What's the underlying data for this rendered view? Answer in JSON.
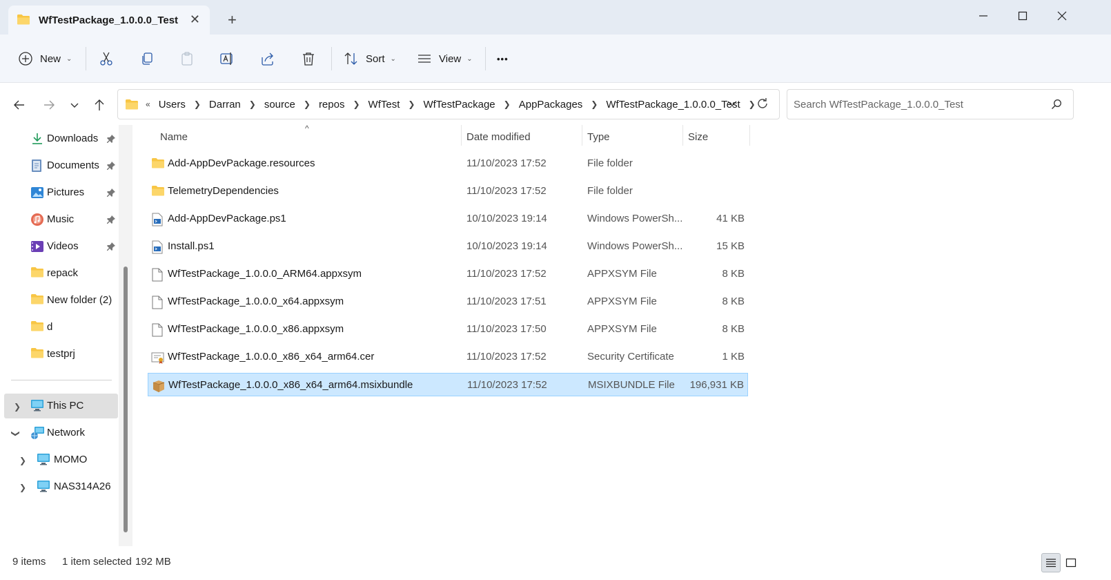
{
  "window": {
    "tab_title": "WfTestPackage_1.0.0.0_Test",
    "new_tab_symbol": "+",
    "close_tab_symbol": "✕"
  },
  "toolbar": {
    "new_label": "New",
    "sort_label": "Sort",
    "view_label": "View",
    "more_symbol": "•••"
  },
  "address": {
    "overflow_symbol": "«",
    "breadcrumbs": [
      "Users",
      "Darran",
      "source",
      "repos",
      "WfTest",
      "WfTestPackage",
      "AppPackages",
      "WfTestPackage_1.0.0.0_Test"
    ]
  },
  "search": {
    "placeholder": "Search WfTestPackage_1.0.0.0_Test"
  },
  "sidebar": {
    "quick_access": [
      {
        "label": "Downloads",
        "icon": "download-icon",
        "pinned": true
      },
      {
        "label": "Documents",
        "icon": "documents-icon",
        "pinned": true
      },
      {
        "label": "Pictures",
        "icon": "pictures-icon",
        "pinned": true
      },
      {
        "label": "Music",
        "icon": "music-icon",
        "pinned": true
      },
      {
        "label": "Videos",
        "icon": "videos-icon",
        "pinned": true
      },
      {
        "label": "repack",
        "icon": "folder-icon",
        "pinned": false
      },
      {
        "label": "New folder (2)",
        "icon": "folder-icon",
        "pinned": false
      },
      {
        "label": "d",
        "icon": "folder-icon",
        "pinned": false
      },
      {
        "label": "testprj",
        "icon": "folder-icon",
        "pinned": false
      }
    ],
    "this_pc": "This PC",
    "network": "Network",
    "network_children": [
      "MOMO",
      "NAS314A26"
    ]
  },
  "columns": {
    "name": "Name",
    "date": "Date modified",
    "type": "Type",
    "size": "Size"
  },
  "files": [
    {
      "name": "Add-AppDevPackage.resources",
      "date": "11/10/2023 17:52",
      "type": "File folder",
      "size": "",
      "icon": "folder-icon"
    },
    {
      "name": "TelemetryDependencies",
      "date": "11/10/2023 17:52",
      "type": "File folder",
      "size": "",
      "icon": "folder-icon"
    },
    {
      "name": "Add-AppDevPackage.ps1",
      "date": "10/10/2023 19:14",
      "type": "Windows PowerSh...",
      "size": "41 KB",
      "icon": "powershell-script-icon"
    },
    {
      "name": "Install.ps1",
      "date": "10/10/2023 19:14",
      "type": "Windows PowerSh...",
      "size": "15 KB",
      "icon": "powershell-script-icon"
    },
    {
      "name": "WfTestPackage_1.0.0.0_ARM64.appxsym",
      "date": "11/10/2023 17:52",
      "type": "APPXSYM File",
      "size": "8 KB",
      "icon": "generic-file-icon"
    },
    {
      "name": "WfTestPackage_1.0.0.0_x64.appxsym",
      "date": "11/10/2023 17:51",
      "type": "APPXSYM File",
      "size": "8 KB",
      "icon": "generic-file-icon"
    },
    {
      "name": "WfTestPackage_1.0.0.0_x86.appxsym",
      "date": "11/10/2023 17:50",
      "type": "APPXSYM File",
      "size": "8 KB",
      "icon": "generic-file-icon"
    },
    {
      "name": "WfTestPackage_1.0.0.0_x86_x64_arm64.cer",
      "date": "11/10/2023 17:52",
      "type": "Security Certificate",
      "size": "1 KB",
      "icon": "certificate-icon"
    },
    {
      "name": "WfTestPackage_1.0.0.0_x86_x64_arm64.msixbundle",
      "date": "11/10/2023 17:52",
      "type": "MSIXBUNDLE File",
      "size": "196,931 KB",
      "icon": "package-icon",
      "selected": true
    }
  ],
  "status": {
    "item_count": "9 items",
    "selection": "1 item selected",
    "selection_size": "192 MB"
  },
  "colors": {
    "accent": "#0067c0",
    "folder": "#f8c645",
    "selection_bg": "#cce8ff",
    "selection_border": "#99d1ff",
    "titlebar_bg": "#e5ebf3"
  }
}
